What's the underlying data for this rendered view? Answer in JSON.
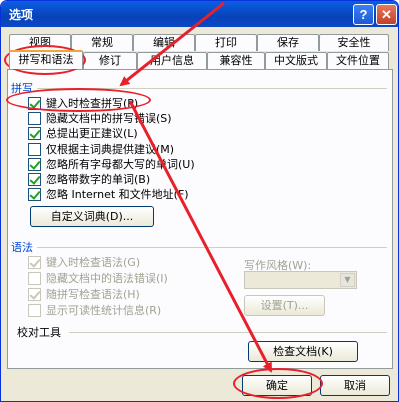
{
  "window": {
    "title": "选项",
    "help_label": "?",
    "close_label": "✕"
  },
  "tabs_row1": [
    "视图",
    "常规",
    "编辑",
    "打印",
    "保存",
    "安全性"
  ],
  "tabs_row2": [
    "拼写和语法",
    "修订",
    "用户信息",
    "兼容性",
    "中文版式",
    "文件位置"
  ],
  "active_tab": "拼写和语法",
  "spelling": {
    "section_label": "拼写",
    "options": [
      {
        "label": "键入时检查拼写(P)",
        "checked": true
      },
      {
        "label": "隐藏文档中的拼写错误(S)",
        "checked": false
      },
      {
        "label": "总提出更正建议(L)",
        "checked": true
      },
      {
        "label": "仅根据主词典提供建议(M)",
        "checked": false
      },
      {
        "label": "忽略所有字母都大写的单词(U)",
        "checked": true
      },
      {
        "label": "忽略带数字的单词(B)",
        "checked": true
      },
      {
        "label": "忽略 Internet 和文件地址(F)",
        "checked": true
      }
    ],
    "custom_dict_button": "自定义词典(D)..."
  },
  "grammar": {
    "section_label": "语法",
    "options": [
      {
        "label": "键入时检查语法(G)",
        "checked": true
      },
      {
        "label": "隐藏文档中的语法错误(I)",
        "checked": false
      },
      {
        "label": "随拼写检查语法(H)",
        "checked": true
      },
      {
        "label": "显示可读性统计信息(R)",
        "checked": false
      }
    ],
    "writing_style_label": "写作风格(W):",
    "writing_style_value": "",
    "settings_button": "设置(T)..."
  },
  "proofing": {
    "section_label": "校对工具",
    "check_doc_button": "检查文档(K)"
  },
  "footer": {
    "ok_label": "确定",
    "cancel_label": "取消"
  },
  "annotation_color": "#e8202a"
}
